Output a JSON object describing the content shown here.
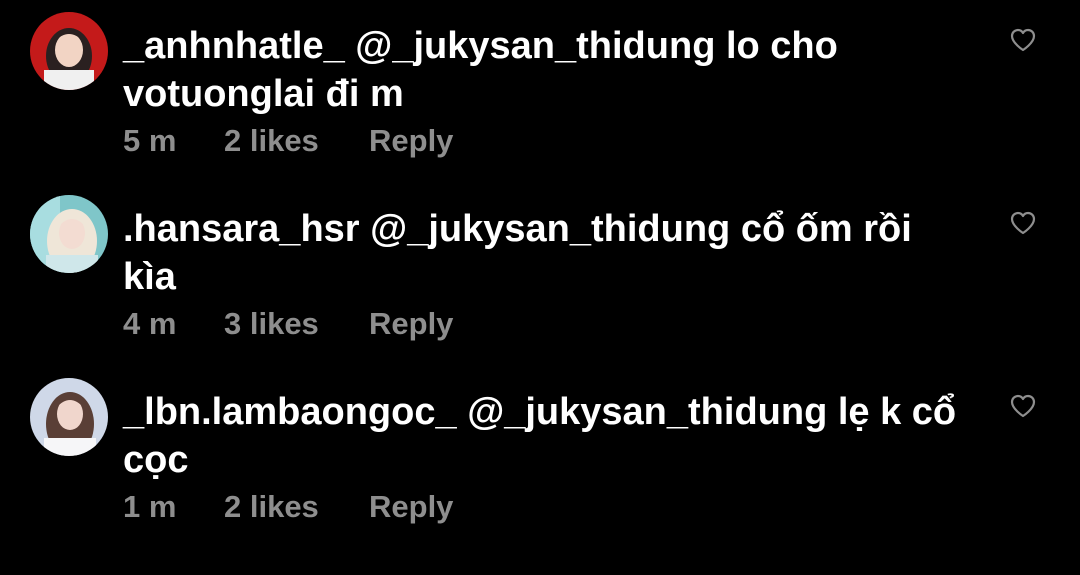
{
  "comments": [
    {
      "username": "_anhnhatle_",
      "mention": "@_jukysan_thidung",
      "text": "lo cho votuonglai đi m",
      "time": "5 m",
      "likes": "2 likes",
      "reply": "Reply",
      "avatar_colors": {
        "bg": "#c41a1a",
        "skin": "#f2d4c4",
        "hair": "#2a2020",
        "shirt": "#f0f0f0"
      }
    },
    {
      "username": ".hansara_hsr",
      "mention": "@_jukysan_thidung",
      "text": "cổ ốm rồi kìa",
      "time": "4 m",
      "likes": "3 likes",
      "reply": "Reply",
      "avatar_colors": {
        "bg": "#7fc6c9",
        "skin": "#f3dcd2",
        "hair": "#efe6d8",
        "shirt": "#cfe7ea"
      }
    },
    {
      "username": "_lbn.lambaongoc_",
      "mention": "@_jukysan_thidung",
      "text": "lẹ k cổ cọc",
      "time": "1 m",
      "likes": "2 likes",
      "reply": "Reply",
      "avatar_colors": {
        "bg": "#cfd8e8",
        "skin": "#f0d6cc",
        "hair": "#5a3f36",
        "shirt": "#f6f6f8"
      }
    }
  ],
  "icons": {
    "like": "heart-outline-icon"
  },
  "colors": {
    "background": "#000000",
    "text": "#ffffff",
    "meta": "#8e8e8e"
  }
}
